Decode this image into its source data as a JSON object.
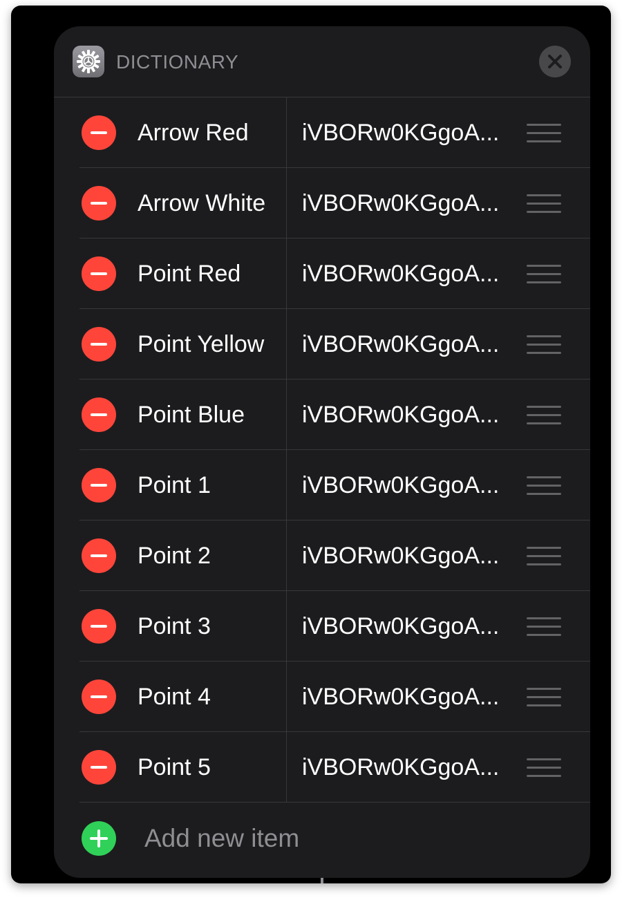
{
  "header": {
    "title": "DICTIONARY",
    "app_icon": "gear-icon",
    "close_icon": "close-icon"
  },
  "items": [
    {
      "key": "Arrow Red",
      "value": "iVBORw0KGgoA..."
    },
    {
      "key": "Arrow White",
      "value": "iVBORw0KGgoA..."
    },
    {
      "key": "Point Red",
      "value": "iVBORw0KGgoA..."
    },
    {
      "key": "Point Yellow",
      "value": "iVBORw0KGgoA..."
    },
    {
      "key": "Point Blue",
      "value": "iVBORw0KGgoA..."
    },
    {
      "key": "Point 1",
      "value": "iVBORw0KGgoA..."
    },
    {
      "key": "Point 2",
      "value": "iVBORw0KGgoA..."
    },
    {
      "key": "Point 3",
      "value": "iVBORw0KGgoA..."
    },
    {
      "key": "Point 4",
      "value": "iVBORw0KGgoA..."
    },
    {
      "key": "Point 5",
      "value": "iVBORw0KGgoA..."
    }
  ],
  "add_item": {
    "label": "Add new item"
  },
  "colors": {
    "panel": "#1c1c1e",
    "remove": "#ff453a",
    "add": "#30d158",
    "separator": "#38383a",
    "muted_text": "#8e8e93"
  }
}
